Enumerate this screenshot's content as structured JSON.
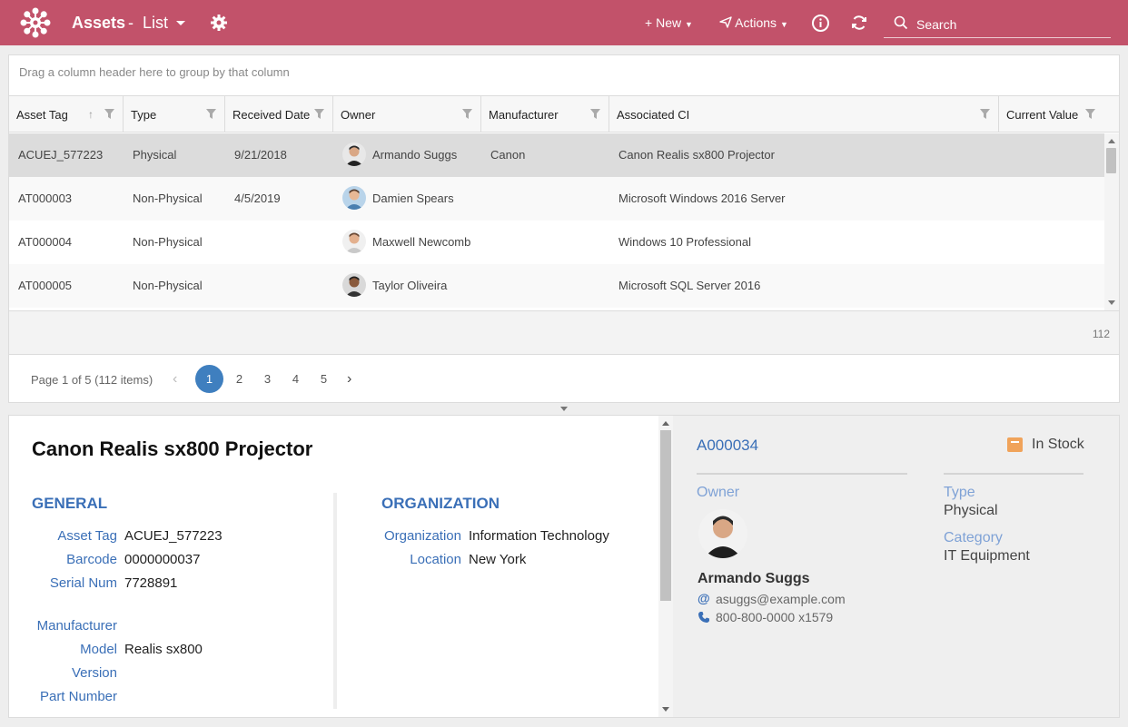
{
  "app": {
    "title": "Assets",
    "separator": "-",
    "view": "List",
    "new_label": "New",
    "actions_label": "Actions",
    "search_placeholder": "Search"
  },
  "grid": {
    "group_hint": "Drag a column header here to group by that column",
    "columns": [
      "Asset Tag",
      "Type",
      "Received Date",
      "Owner",
      "Manufacturer",
      "Associated CI",
      "Current Value"
    ],
    "rows": [
      {
        "asset_tag": "ACUEJ_577223",
        "type": "Physical",
        "received": "9/21/2018",
        "owner": "Armando Suggs",
        "manufacturer": "Canon",
        "ci": "Canon Realis sx800 Projector",
        "value": ""
      },
      {
        "asset_tag": "AT000003",
        "type": "Non-Physical",
        "received": "4/5/2019",
        "owner": "Damien Spears",
        "manufacturer": "",
        "ci": "Microsoft Windows 2016 Server",
        "value": ""
      },
      {
        "asset_tag": "AT000004",
        "type": "Non-Physical",
        "received": "",
        "owner": "Maxwell Newcomb",
        "manufacturer": "",
        "ci": "Windows 10 Professional",
        "value": ""
      },
      {
        "asset_tag": "AT000005",
        "type": "Non-Physical",
        "received": "",
        "owner": "Taylor Oliveira",
        "manufacturer": "",
        "ci": "Microsoft SQL Server 2016",
        "value": ""
      }
    ],
    "footer_count": "112",
    "pager": {
      "info": "Page 1 of 5 (112 items)",
      "pages": [
        "1",
        "2",
        "3",
        "4",
        "5"
      ],
      "current": "1"
    }
  },
  "detail": {
    "heading": "Canon Realis sx800 Projector",
    "general": {
      "title": "GENERAL",
      "asset_tag_label": "Asset Tag",
      "asset_tag": "ACUEJ_577223",
      "barcode_label": "Barcode",
      "barcode": "0000000037",
      "serial_label": "Serial Num",
      "serial": "7728891",
      "manufacturer_label": "Manufacturer",
      "manufacturer": "",
      "model_label": "Model",
      "model": "Realis sx800",
      "version_label": "Version",
      "version": "",
      "part_label": "Part Number",
      "part": ""
    },
    "organization": {
      "title": "ORGANIZATION",
      "org_label": "Organization",
      "org": "Information Technology",
      "location_label": "Location",
      "location": "New York"
    },
    "side": {
      "tag": "A000034",
      "status": "In Stock",
      "status_color": "#f0a35a",
      "owner_label": "Owner",
      "owner_name": "Armando Suggs",
      "owner_email": "asuggs@example.com",
      "owner_phone": "800-800-0000 x1579",
      "type_label": "Type",
      "type": "Physical",
      "category_label": "Category",
      "category": "IT Equipment"
    }
  },
  "colors": {
    "topbar": "#c2526a",
    "accent": "#3a6fb7",
    "selected_row": "#dcdcdc"
  }
}
